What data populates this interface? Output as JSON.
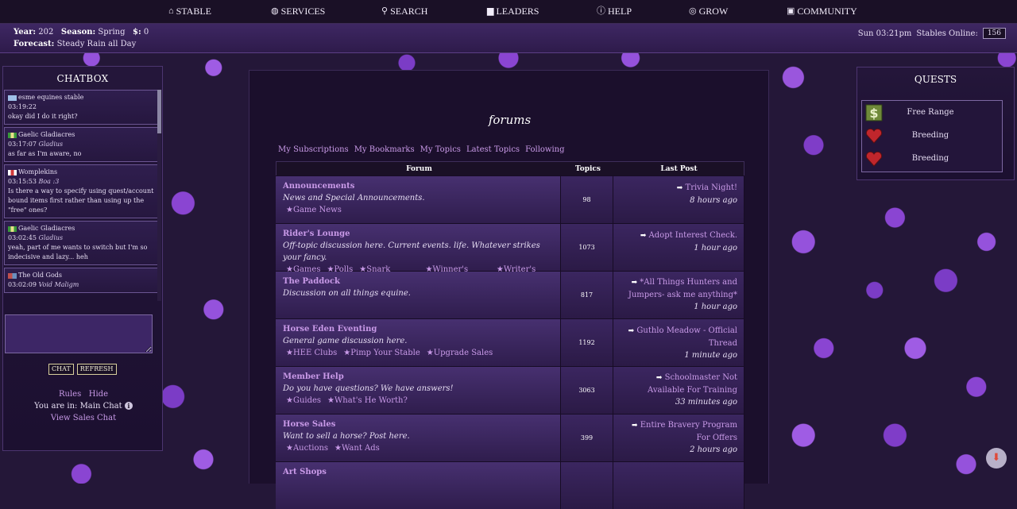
{
  "nav": {
    "items": [
      {
        "label": "STABLE",
        "icon": "home-icon"
      },
      {
        "label": "SERVICES",
        "icon": "globe-icon"
      },
      {
        "label": "SEARCH",
        "icon": "search-icon"
      },
      {
        "label": "LEADERS",
        "icon": "bar-chart-icon"
      },
      {
        "label": "HELP",
        "icon": "info-icon"
      },
      {
        "label": "GROW",
        "icon": "target-icon"
      },
      {
        "label": "COMMUNITY",
        "icon": "chat-bubble-icon"
      }
    ]
  },
  "info": {
    "year_label": "Year:",
    "year": "202",
    "season_label": "Season:",
    "season": "Spring",
    "money_label": "$:",
    "money": "0",
    "forecast_label": "Forecast:",
    "forecast": "Steady Rain all Day",
    "time": "Sun 03:21pm",
    "stables_online_label": "Stables Online:",
    "stables_online": "156"
  },
  "chat": {
    "title": "CHATBOX",
    "messages": [
      {
        "user": "esme equines stable",
        "time": "03:19:22",
        "tag": "",
        "text": "okay did I do it right?",
        "flag": "#9fc0e8"
      },
      {
        "user": "Gaelic Gladiacres",
        "time": "03:17:07",
        "tag": "Gladius",
        "text": "as far as I'm aware, no",
        "flag": "#3a9a3a"
      },
      {
        "user": "Womplekins",
        "time": "03:15:53",
        "tag": "Boa :3",
        "text": "Is there a way to specify using quest/account bound items first rather than using up the \"free\" ones?",
        "flag": "#d23b3b"
      },
      {
        "user": "Gaelic Gladiacres",
        "time": "03:02:45",
        "tag": "Gladius",
        "text": "yeah, part of me wants to switch but I'm so indecisive and lazy... heh",
        "flag": "#3a9a3a"
      },
      {
        "user": "The Old Gods",
        "time": "03:02:09",
        "tag": "Void Maligm",
        "text": "",
        "flag": "#c0504d"
      }
    ],
    "chat_button": "CHAT",
    "refresh_button": "REFRESH",
    "rules_link": "Rules",
    "hide_link": "Hide",
    "location_label": "You are in:",
    "location": "Main Chat",
    "sales_link": "View Sales Chat"
  },
  "forums": {
    "title": "forums",
    "subnav": [
      "My Subscriptions",
      "My Bookmarks",
      "My Topics",
      "Latest Topics",
      "Following"
    ],
    "columns": [
      "Forum",
      "Topics",
      "Last Post"
    ],
    "rows": [
      {
        "name": "Announcements",
        "desc": "News and Special Announcements.",
        "subs": [
          "★Game News"
        ],
        "topics": "98",
        "last_title": "Trivia Night!",
        "last_time": "8 hours ago"
      },
      {
        "name": "Rider's Lounge",
        "desc": "Off-topic discussion here. Current events. life. Whatever strikes your fancy.",
        "subs": [
          "★Games",
          "★Polls",
          "★Snark Factory",
          "★Winner's Circle",
          "★Writer's Nook"
        ],
        "topics": "1073",
        "last_title": "Adopt Interest Check.",
        "last_time": "1 hour ago"
      },
      {
        "name": "The Paddock",
        "desc": "Discussion on all things equine.",
        "subs": [],
        "topics": "817",
        "last_title": "*All Things Hunters and Jumpers- ask me anything*",
        "last_time": "1 hour ago"
      },
      {
        "name": "Horse Eden Eventing",
        "desc": "General game discussion here.",
        "subs": [
          "★HEE Clubs",
          "★Pimp Your Stable",
          "★Upgrade Sales"
        ],
        "topics": "1192",
        "last_title": "Guthlo Meadow - Official Thread",
        "last_time": "1 minute ago"
      },
      {
        "name": "Member Help",
        "desc": "Do you have questions? We have answers!",
        "subs": [
          "★Guides",
          "★What's He Worth?"
        ],
        "topics": "3063",
        "last_title": "Schoolmaster Not Available For Training",
        "last_time": "33 minutes ago"
      },
      {
        "name": "Horse Sales",
        "desc": "Want to sell a horse? Post here.",
        "subs": [
          "★Auctions",
          "★Want Ads"
        ],
        "topics": "399",
        "last_title": "Entire Bravery Program For Offers",
        "last_time": "2 hours ago"
      },
      {
        "name": "Art Shops",
        "desc": "",
        "subs": [],
        "topics": "",
        "last_title": "",
        "last_time": ""
      }
    ]
  },
  "quests": {
    "title": "QUESTS",
    "items": [
      {
        "label": "Free Range",
        "icon": "money-icon"
      },
      {
        "label": "Breeding",
        "icon": "heart-icon"
      },
      {
        "label": "Breeding",
        "icon": "heart-icon"
      }
    ]
  },
  "colors": {
    "accent_link": "#c99ae8",
    "background": "#1b0f2c",
    "header": "#1a1026"
  }
}
